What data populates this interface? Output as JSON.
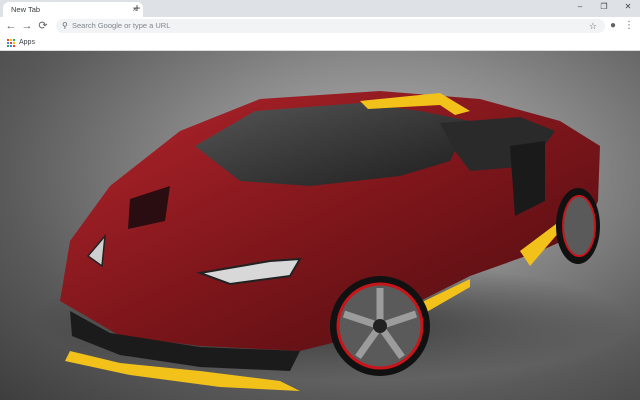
{
  "browser": {
    "tab_title": "New Tab",
    "tab_close": "×",
    "new_tab": "+",
    "window": {
      "minimize": "–",
      "restore": "❐",
      "close": "✕"
    }
  },
  "toolbar": {
    "back": "←",
    "forward": "→",
    "reload": "⟳",
    "omnibox_placeholder": "Search Google or type a URL",
    "search_glyph": "⚲",
    "star": "☆",
    "profile": "●",
    "menu": "⋮"
  },
  "bookmarks": {
    "apps_label": "Apps",
    "apps_colors": [
      "#ea4335",
      "#fbbc05",
      "#34a853",
      "#4285f4",
      "#ea4335",
      "#fbbc05",
      "#34a853",
      "#4285f4",
      "#ea4335"
    ]
  },
  "wallpaper": {
    "subject": "red supercar",
    "body_color": "#8b1a1f",
    "accent_color": "#f2c21b"
  }
}
